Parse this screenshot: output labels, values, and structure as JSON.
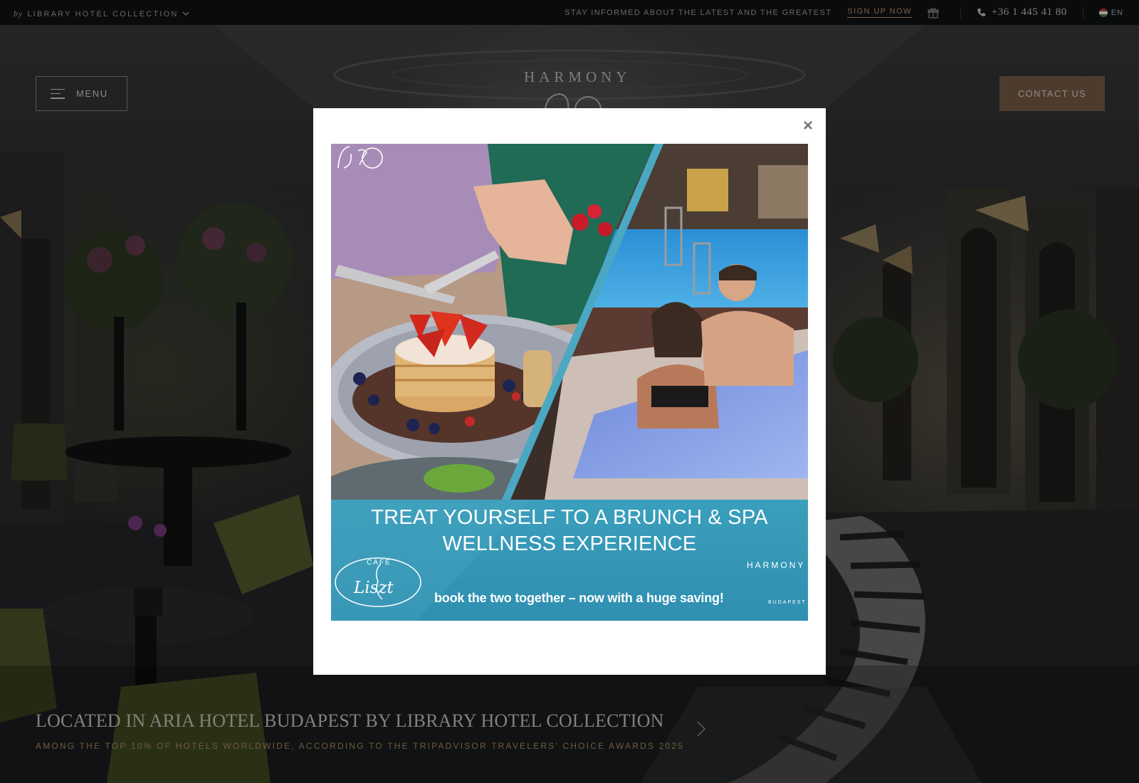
{
  "topbar": {
    "collection_by": "by",
    "collection_label": "LIBRARY HOTEL COLLECTION",
    "stay_informed": "STAY INFORMED ABOUT THE LATEST AND THE GREATEST",
    "signup": "SIGN UP NOW",
    "phone": "+36 1 445 41 80",
    "language": "EN"
  },
  "header": {
    "menu_label": "MENU",
    "logo_text": "HARMONY",
    "contact_label": "CONTACT US"
  },
  "hero": {
    "title": "LOCATED IN ARIA HOTEL BUDAPEST BY LIBRARY HOTEL COLLECTION",
    "subtitle": "AMONG THE TOP 10% OF HOTELS WORLDWIDE, ACCORDING TO THE TRIPADVISOR TRAVELERS' CHOICE AWARDS 2025"
  },
  "modal": {
    "close_label": "×",
    "headline_line1": "TREAT YOURSELF TO A BRUNCH & SPA",
    "headline_line2": "WELLNESS EXPERIENCE",
    "tagline": "book the two together – now with a huge saving!",
    "cafe_label": "CAFE",
    "cafe_name": "Liszt",
    "spa_logo": "HARMONY",
    "spa_city": "BUDAPEST"
  },
  "colors": {
    "accent": "#c4a06c",
    "contact_button": "#7d6249",
    "banner_blue": "#3aa0bd",
    "topbar": "#111214"
  },
  "icons": [
    "chevron-down-icon",
    "gift-icon",
    "phone-icon",
    "flag-icon",
    "hamburger-icon",
    "close-icon",
    "chevron-right-icon"
  ]
}
